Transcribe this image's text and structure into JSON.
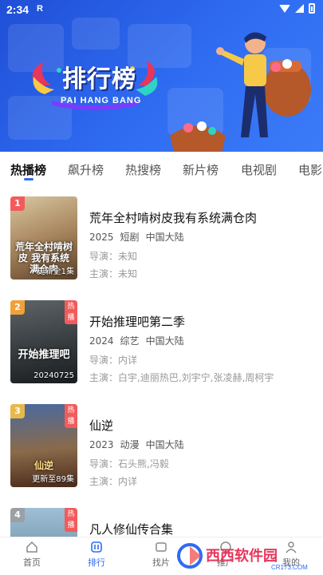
{
  "status": {
    "time": "2:34",
    "notif": "R"
  },
  "banner": {
    "title": "排行榜",
    "subtitle": "PAI HANG BANG"
  },
  "tabs": [
    "热播榜",
    "飙升榜",
    "热搜榜",
    "新片榜",
    "电视剧",
    "电影"
  ],
  "active_tab": 0,
  "items": [
    {
      "rank": "1",
      "title": "荒年全村啃树皮我有系统满仓肉",
      "year": "2025",
      "genre": "短剧",
      "region": "中国大陆",
      "director": "导演：未知",
      "cast": "主演：未知",
      "poster_caption": "更新全1集",
      "poster_art": "荒年全村啃树皮 我有系统满仓肉",
      "hot": "",
      "rank_color": "#f35b5b",
      "poster_colors": [
        "#c9b38a",
        "#7a5a3a"
      ]
    },
    {
      "rank": "2",
      "title": "开始推理吧第二季",
      "year": "2024",
      "genre": "综艺",
      "region": "中国大陆",
      "director": "导演：内详",
      "cast": "主演：白宇,迪丽热巴,刘宇宁,张凌赫,周柯宇",
      "poster_caption": "20240725",
      "poster_art": "开始推理吧",
      "hot": "热播",
      "rank_color": "#f0a13a",
      "poster_colors": [
        "#4a4f52",
        "#1f2326"
      ]
    },
    {
      "rank": "3",
      "title": "仙逆",
      "year": "2023",
      "genre": "动漫",
      "region": "中国大陆",
      "director": "导演：石头熊,冯毅",
      "cast": "主演：内详",
      "poster_caption": "更新至89集",
      "poster_art": "仙逆",
      "hot": "热播",
      "rank_color": "#e8b94a",
      "poster_colors": [
        "#3a5a8a",
        "#5a2f20"
      ]
    },
    {
      "rank": "4",
      "title": "凡人修仙传合集",
      "year": "",
      "genre": "",
      "region": "",
      "director": "",
      "cast": "",
      "poster_caption": "",
      "poster_art": "",
      "hot": "热播",
      "rank_color": "#9aa0a6",
      "poster_colors": [
        "#8fb0c8",
        "#4a6a82"
      ]
    }
  ],
  "bottom_nav": [
    {
      "label": "首页",
      "icon": "home-icon"
    },
    {
      "label": "排行",
      "icon": "ranking-icon"
    },
    {
      "label": "找片",
      "icon": "find-icon"
    },
    {
      "label": "推广",
      "icon": "promo-icon"
    },
    {
      "label": "我的",
      "icon": "user-icon"
    }
  ],
  "active_nav": 1,
  "watermark": "西西软件园",
  "watermark_sub": "CR173.COM",
  "colors": {
    "accent": "#2f6cf2",
    "hot": "#f35b5b",
    "banner": "#2f6cf2"
  }
}
